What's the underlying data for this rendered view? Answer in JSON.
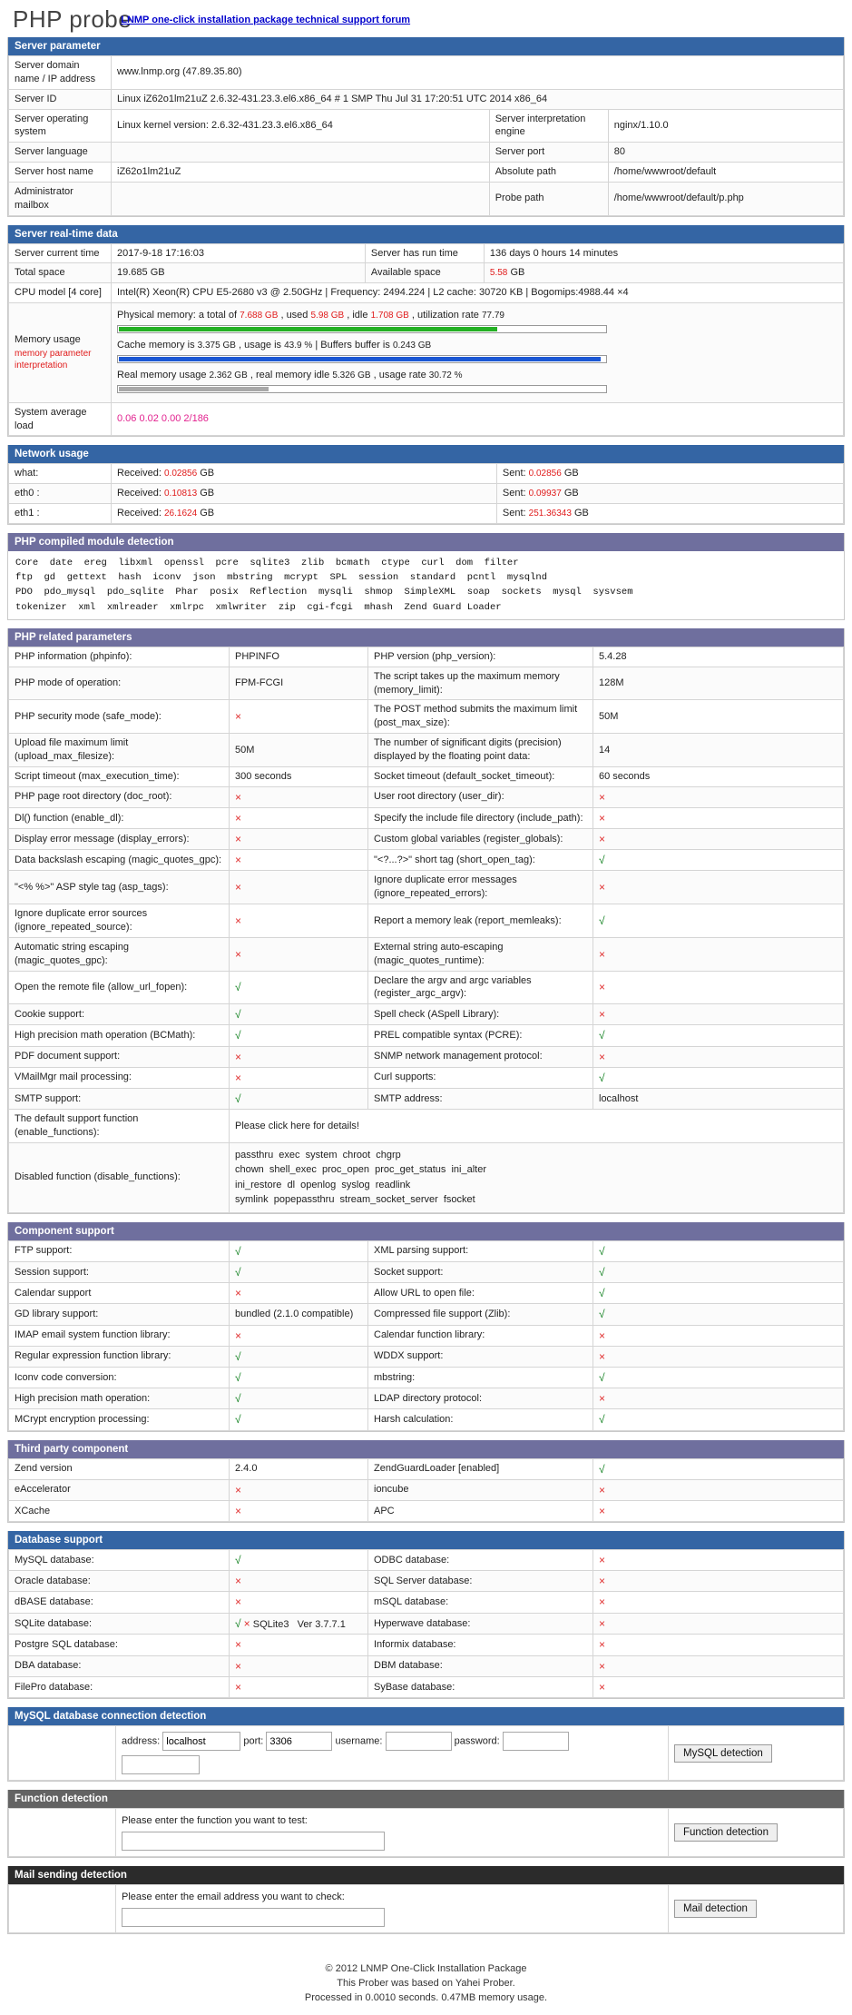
{
  "header": {
    "logo": "PHP probe",
    "link": "LNMP one-click installation package technical support forum"
  },
  "server_parameter": {
    "title": "Server parameter",
    "rows": [
      {
        "label": "Server domain name / IP address",
        "value": "www.lnmp.org (47.89.35.80)"
      },
      {
        "label": "Server ID",
        "value": "Linux iZ62o1lm21uZ 2.6.32-431.23.3.el6.x86_64 # 1 SMP Thu Jul 31 17:20:51 UTC 2014 x86_64"
      },
      {
        "label": "Server operating system",
        "value": "Linux kernel version: 2.6.32-431.23.3.el6.x86_64",
        "label2": "Server interpretation engine",
        "value2": "nginx/1.10.0"
      },
      {
        "label": "Server language",
        "value": "",
        "label2": "Server port",
        "value2": "80"
      },
      {
        "label": "Server host name",
        "value": "iZ62o1lm21uZ",
        "label2": "Absolute path",
        "value2": "/home/wwwroot/default"
      },
      {
        "label": "Administrator mailbox",
        "value": "",
        "label2": "Probe path",
        "value2": "/home/wwwroot/default/p.php"
      }
    ]
  },
  "realtime": {
    "title": "Server real-time data",
    "current_time_label": "Server current time",
    "current_time": "2017-9-18 17:16:03",
    "run_time_label": "Server has run time",
    "run_time": "136 days 0 hours 14 minutes",
    "total_space_label": "Total space",
    "total_space": "19.685 GB",
    "available_space_label": "Available space",
    "available_space_value": "5.58",
    "available_space_unit": "GB",
    "cpu_label": "CPU model [4 core]",
    "cpu_value": "Intel(R) Xeon(R) CPU E5-2680 v3 @ 2.50GHz | Frequency: 2494.224 | L2 cache: 30720 KB | Bogomips:4988.44 ×4",
    "memory_label": "Memory usage",
    "memory_note": "memory parameter interpretation",
    "physical": {
      "prefix": "Physical memory: a total of",
      "total": "7.688 GB",
      "mid1": ", used",
      "used": "5.98 GB",
      "mid2": ", idle",
      "idle": "1.708 GB",
      "mid3": ", utilization rate",
      "rate": "77.79",
      "percent": 77.79
    },
    "cache": {
      "prefix": "Cache memory is",
      "size": "3.375 GB",
      "mid1": ", usage is",
      "usage": "43.9 %",
      "mid2": "| Buffers buffer is",
      "buffers": "0.243 GB",
      "percent": 99
    },
    "real": {
      "prefix": "Real memory usage",
      "used": "2.362 GB",
      "mid1": ", real memory idle",
      "idle": "5.326 GB",
      "mid2": ", usage rate",
      "rate": "30.72 %",
      "percent": 30.72
    },
    "load_label": "System average load",
    "load_value": "0.06 0.02 0.00 2/186"
  },
  "network": {
    "title": "Network usage",
    "received_label": "Received:",
    "sent_label": "Sent:",
    "rows": [
      {
        "iface": "what:",
        "received": "0.02856",
        "unit": "GB",
        "sent": "0.02856",
        "sent_unit": "GB"
      },
      {
        "iface": "eth0 :",
        "received": "0.10813",
        "unit": "GB",
        "sent": "0.09937",
        "sent_unit": "GB"
      },
      {
        "iface": "eth1 :",
        "received": "26.1624",
        "unit": "GB",
        "sent": "251.36343",
        "sent_unit": "GB"
      }
    ]
  },
  "modules": {
    "title": "PHP compiled module detection",
    "text": "Core  date  ereg  libxml  openssl  pcre  sqlite3  zlib  bcmath  ctype  curl  dom  filter\nftp  gd  gettext  hash  iconv  json  mbstring  mcrypt  SPL  session  standard  pcntl  mysqlnd\nPDO  pdo_mysql  pdo_sqlite  Phar  posix  Reflection  mysqli  shmop  SimpleXML  soap  sockets  mysql  sysvsem\ntokenizer  xml  xmlreader  xmlrpc  xmlwriter  zip  cgi-fcgi  mhash  Zend Guard Loader"
  },
  "php_params": {
    "title": "PHP related parameters",
    "rows": [
      {
        "l1": "PHP information (phpinfo):",
        "v1": "PHPINFO",
        "v1type": "text",
        "l2": "PHP version (php_version):",
        "v2": "5.4.28",
        "v2type": "text"
      },
      {
        "l1": "PHP mode of operation:",
        "v1": "FPM-FCGI",
        "v1type": "text",
        "l2": "The script takes up the maximum memory (memory_limit):",
        "v2": "128M",
        "v2type": "text"
      },
      {
        "l1": "PHP security mode (safe_mode):",
        "v1": "×",
        "v1type": "no",
        "l2": "The POST method submits the maximum limit (post_max_size):",
        "v2": "50M",
        "v2type": "text"
      },
      {
        "l1": "Upload file maximum limit (upload_max_filesize):",
        "v1": "50M",
        "v1type": "text",
        "l2": "The number of significant digits (precision) displayed by the floating point data:",
        "v2": "14",
        "v2type": "text"
      },
      {
        "l1": "Script timeout (max_execution_time):",
        "v1": "300 seconds",
        "v1type": "text",
        "l2": "Socket timeout (default_socket_timeout):",
        "v2": "60 seconds",
        "v2type": "text"
      },
      {
        "l1": "PHP page root directory (doc_root):",
        "v1": "×",
        "v1type": "no",
        "l2": "User root directory (user_dir):",
        "v2": "×",
        "v2type": "no"
      },
      {
        "l1": "Dl() function (enable_dl):",
        "v1": "×",
        "v1type": "no",
        "l2": "Specify the include file directory (include_path):",
        "v2": "×",
        "v2type": "no"
      },
      {
        "l1": "Display error message (display_errors):",
        "v1": "×",
        "v1type": "no",
        "l2": "Custom global variables (register_globals):",
        "v2": "×",
        "v2type": "no"
      },
      {
        "l1": "Data backslash escaping (magic_quotes_gpc):",
        "v1": "×",
        "v1type": "no",
        "l2": "\"<?...?>\" short tag (short_open_tag):",
        "v2": "√",
        "v2type": "ok"
      },
      {
        "l1": "\"<% %>\" ASP style tag (asp_tags):",
        "v1": "×",
        "v1type": "no",
        "l2": "Ignore duplicate error messages (ignore_repeated_errors):",
        "v2": "×",
        "v2type": "no"
      },
      {
        "l1": "Ignore duplicate error sources (ignore_repeated_source):",
        "v1": "×",
        "v1type": "no",
        "l2": "Report a memory leak (report_memleaks):",
        "v2": "√",
        "v2type": "ok"
      },
      {
        "l1": "Automatic string escaping (magic_quotes_gpc):",
        "v1": "×",
        "v1type": "no",
        "l2": "External string auto-escaping (magic_quotes_runtime):",
        "v2": "×",
        "v2type": "no"
      },
      {
        "l1": "Open the remote file (allow_url_fopen):",
        "v1": "√",
        "v1type": "ok",
        "l2": "Declare the argv and argc variables (register_argc_argv):",
        "v2": "×",
        "v2type": "no"
      },
      {
        "l1": "Cookie support:",
        "v1": "√",
        "v1type": "ok",
        "l2": "Spell check (ASpell Library):",
        "v2": "×",
        "v2type": "no"
      },
      {
        "l1": "High precision math operation (BCMath):",
        "v1": "√",
        "v1type": "ok",
        "l2": "PREL compatible syntax (PCRE):",
        "v2": "√",
        "v2type": "ok"
      },
      {
        "l1": "PDF document support:",
        "v1": "×",
        "v1type": "no",
        "l2": "SNMP network management protocol:",
        "v2": "×",
        "v2type": "no"
      },
      {
        "l1": "VMailMgr mail processing:",
        "v1": "×",
        "v1type": "no",
        "l2": "Curl supports:",
        "v2": "√",
        "v2type": "ok"
      },
      {
        "l1": "SMTP support:",
        "v1": "√",
        "v1type": "ok",
        "l2": "SMTP address:",
        "v2": "localhost",
        "v2type": "text"
      }
    ],
    "enable_functions_label": "The default support function (enable_functions):",
    "enable_functions_value": "Please click here for details!",
    "disable_functions_label": "Disabled function (disable_functions):",
    "disable_functions_value": "passthru  exec  system  chroot  chgrp\nchown  shell_exec  proc_open  proc_get_status  ini_alter\nini_restore  dl  openlog  syslog  readlink\nsymlink  popepassthru  stream_socket_server  fsocket"
  },
  "component": {
    "title": "Component support",
    "rows": [
      {
        "l1": "FTP support:",
        "v1": "√",
        "v1type": "ok",
        "l2": "XML parsing support:",
        "v2": "√",
        "v2type": "ok"
      },
      {
        "l1": "Session support:",
        "v1": "√",
        "v1type": "ok",
        "l2": "Socket support:",
        "v2": "√",
        "v2type": "ok"
      },
      {
        "l1": "Calendar support",
        "v1": "×",
        "v1type": "no",
        "l2": "Allow URL to open file:",
        "v2": "√",
        "v2type": "ok"
      },
      {
        "l1": "GD library support:",
        "v1": "bundled (2.1.0 compatible)",
        "v1type": "text",
        "l2": "Compressed file support (Zlib):",
        "v2": "√",
        "v2type": "ok"
      },
      {
        "l1": "IMAP email system function library:",
        "v1": "×",
        "v1type": "no",
        "l2": "Calendar function library:",
        "v2": "×",
        "v2type": "no"
      },
      {
        "l1": "Regular expression function library:",
        "v1": "√",
        "v1type": "ok",
        "l2": "WDDX support:",
        "v2": "×",
        "v2type": "no"
      },
      {
        "l1": "Iconv code conversion:",
        "v1": "√",
        "v1type": "ok",
        "l2": "mbstring:",
        "v2": "√",
        "v2type": "ok"
      },
      {
        "l1": "High precision math operation:",
        "v1": "√",
        "v1type": "ok",
        "l2": "LDAP directory protocol:",
        "v2": "×",
        "v2type": "no"
      },
      {
        "l1": "MCrypt encryption processing:",
        "v1": "√",
        "v1type": "ok",
        "l2": "Harsh calculation:",
        "v2": "√",
        "v2type": "ok"
      }
    ]
  },
  "third_party": {
    "title": "Third party component",
    "rows": [
      {
        "l1": "Zend version",
        "v1": "2.4.0",
        "v1type": "text",
        "l2": "ZendGuardLoader [enabled]",
        "v2": "√",
        "v2type": "ok"
      },
      {
        "l1": "eAccelerator",
        "v1": "×",
        "v1type": "no",
        "l2": "ioncube",
        "v2": "×",
        "v2type": "no"
      },
      {
        "l1": "XCache",
        "v1": "×",
        "v1type": "no",
        "l2": "APC",
        "v2": "×",
        "v2type": "no"
      }
    ]
  },
  "database": {
    "title": "Database support",
    "rows": [
      {
        "l1": "MySQL database:",
        "v1": "√",
        "v1type": "ok",
        "l2": "ODBC database:",
        "v2": "×",
        "v2type": "no"
      },
      {
        "l1": "Oracle database:",
        "v1": "×",
        "v1type": "no",
        "l2": "SQL Server database:",
        "v2": "×",
        "v2type": "no"
      },
      {
        "l1": "dBASE database:",
        "v1": "×",
        "v1type": "no",
        "l2": "mSQL database:",
        "v2": "×",
        "v2type": "no"
      },
      {
        "l1": "SQLite database:",
        "v1": "√   SQLite3   Ver 3.7.7.1",
        "v1type": "sqlite",
        "l2": "Hyperwave database:",
        "v2": "×",
        "v2type": "no"
      },
      {
        "l1": "Postgre SQL database:",
        "v1": "×",
        "v1type": "no",
        "l2": "Informix database:",
        "v2": "×",
        "v2type": "no"
      },
      {
        "l1": "DBA database:",
        "v1": "×",
        "v1type": "no",
        "l2": "DBM database:",
        "v2": "×",
        "v2type": "no"
      },
      {
        "l1": "FilePro database:",
        "v1": "×",
        "v1type": "no",
        "l2": "SyBase database:",
        "v2": "×",
        "v2type": "no"
      }
    ]
  },
  "mysql_detection": {
    "title": "MySQL database connection detection",
    "address_label": "address:",
    "address_value": "localhost",
    "port_label": "port:",
    "port_value": "3306",
    "username_label": "username:",
    "username_value": "",
    "password_label": "password:",
    "password_value": "",
    "button": "MySQL detection"
  },
  "function_detection": {
    "title": "Function detection",
    "prompt": "Please enter the function you want to test:",
    "value": "",
    "button": "Function detection"
  },
  "mail_detection": {
    "title": "Mail sending detection",
    "prompt": "Please enter the email address you want to check:",
    "value": "",
    "button": "Mail detection"
  },
  "footer": {
    "line1": "© 2012 LNMP One-Click Installation Package",
    "line2": "This Prober was based on Yahei Prober.",
    "line3": "Processed in 0.0010 seconds. 0.47MB memory usage."
  }
}
